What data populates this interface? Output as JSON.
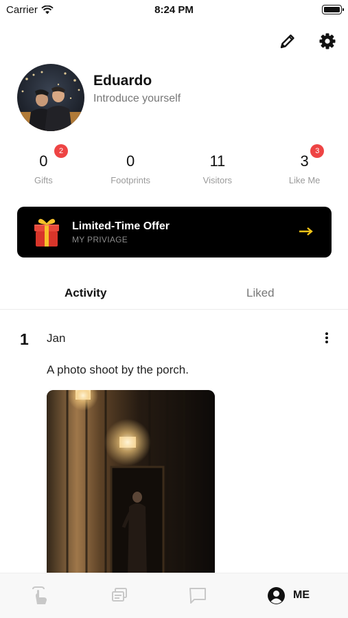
{
  "status_bar": {
    "carrier": "Carrier",
    "time": "8:24 PM"
  },
  "profile": {
    "name": "Eduardo",
    "intro": "Introduce yourself"
  },
  "stats": [
    {
      "value": "0",
      "label": "Gifts",
      "badge": "2"
    },
    {
      "value": "0",
      "label": "Footprints",
      "badge": ""
    },
    {
      "value": "11",
      "label": "Visitors",
      "badge": ""
    },
    {
      "value": "3",
      "label": "Like Me",
      "badge": "3"
    }
  ],
  "offer": {
    "title": "Limited-Time Offer",
    "subtitle": "MY PRIVIAGE",
    "arrow_color": "#f5c518"
  },
  "tabs": {
    "activity": "Activity",
    "liked": "Liked"
  },
  "post": {
    "day": "1",
    "month": "Jan",
    "text": "A photo shoot by the porch."
  },
  "bottom_nav": {
    "me_label": "ME",
    "icons": [
      "tap-hand-icon",
      "cards-stack-icon",
      "chat-bubble-icon",
      "profile-icon"
    ]
  },
  "colors": {
    "badge": "#ee4444",
    "banner_bg": "#000000",
    "accent": "#f5c518"
  }
}
